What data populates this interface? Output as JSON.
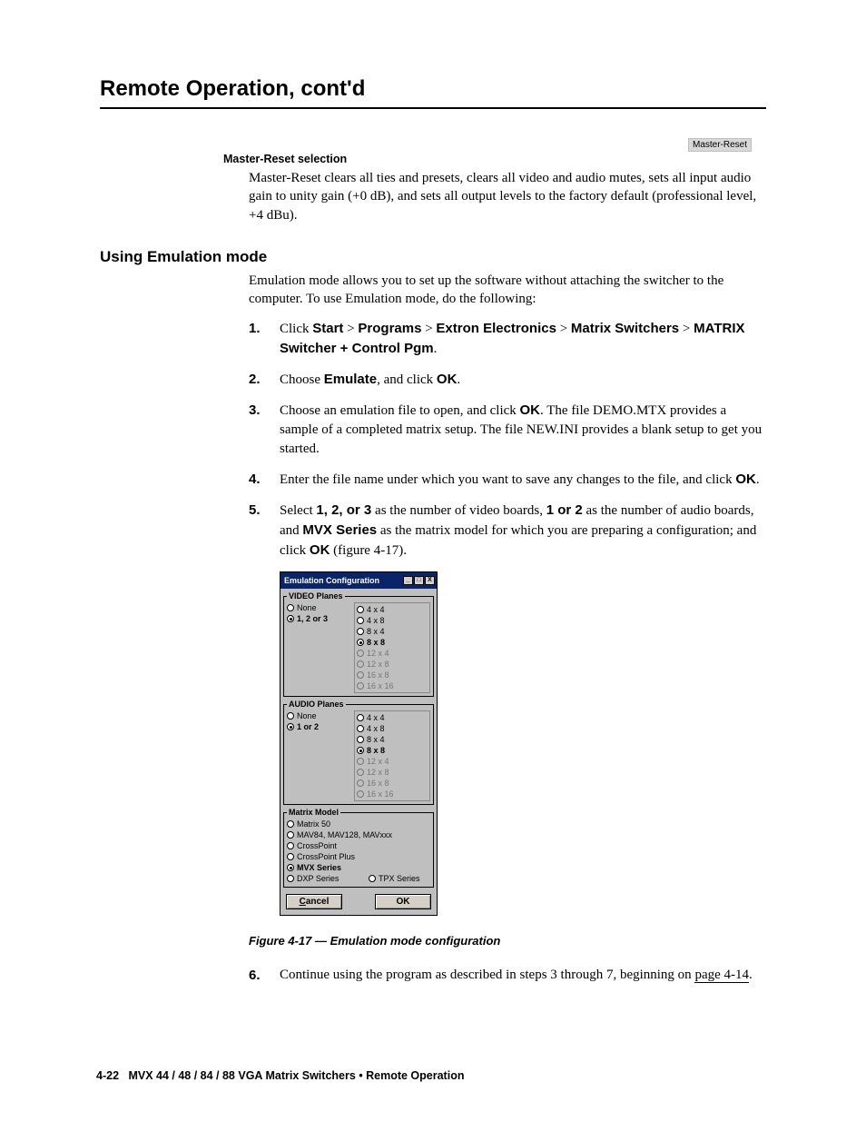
{
  "chapter_title": "Remote Operation, cont'd",
  "master_reset": {
    "heading": "Master-Reset selection",
    "body": "Master-Reset clears all ties and presets, clears all video and audio mutes, sets all input audio gain to unity gain (+0 dB), and sets all output levels to the factory default (professional level, +4 dBu).",
    "badge": "Master-Reset"
  },
  "emu": {
    "heading": "Using Emulation mode",
    "intro": "Emulation mode allows you to set up the software without attaching the switcher to the computer.  To use Emulation mode, do the following:",
    "steps": {
      "s1": {
        "num": "1.",
        "pre": "Click ",
        "b1": "Start",
        "g1": " > ",
        "b2": "Programs",
        "g2": " > ",
        "b3": "Extron Electronics",
        "g3": " > ",
        "b4": "Matrix Switchers",
        "g4": " > ",
        "b5": "MATRIX Switcher + Control Pgm",
        "post": "."
      },
      "s2": {
        "num": "2.",
        "pre": "Choose ",
        "b1": "Emulate",
        "mid": ", and click ",
        "b2": "OK",
        "post": "."
      },
      "s3": {
        "num": "3.",
        "pre": "Choose an emulation file to open, and click ",
        "b1": "OK",
        "post": ".  The file DEMO.MTX provides a sample of a completed matrix setup.  The file NEW.INI provides a blank setup to get you started."
      },
      "s4": {
        "num": "4.",
        "pre": "Enter the file name under which you want to save any changes to the file, and click ",
        "b1": "OK",
        "post": "."
      },
      "s5": {
        "num": "5.",
        "pre": "Select ",
        "b1": "1, 2, or 3",
        "mid1": " as the number of video boards, ",
        "b2": "1 or 2",
        "mid2": " as the number of audio boards, and ",
        "b3": "MVX Series",
        "mid3": " as the matrix model for which you are preparing a configuration; and click ",
        "b4": "OK",
        "post": " (figure 4-17)."
      },
      "s6": {
        "num": "6.",
        "pre": "Continue using the program as described in steps 3 through 7, beginning on ",
        "link": "page 4-14",
        "post": "."
      }
    }
  },
  "dialog": {
    "title": "Emulation Configuration",
    "video_legend": "VIDEO Planes",
    "audio_legend": "AUDIO Planes",
    "model_legend": "Matrix Model",
    "video_left": {
      "none": "None",
      "sel": "1, 2 or 3"
    },
    "audio_left": {
      "none": "None",
      "sel": "1 or 2"
    },
    "sizes": {
      "s4x4": "4 x 4",
      "s4x8": "4 x 8",
      "s8x4": "8 x 4",
      "s8x8": "8 x 8",
      "s12x4": "12 x 4",
      "s12x8": "12 x 8",
      "s16x8": "16 x 8",
      "s16x16": "16 x 16"
    },
    "models": {
      "m50": "Matrix 50",
      "mav": "MAV84,  MAV128,  MAVxxx",
      "cp": "CrossPoint",
      "cpp": "CrossPoint Plus",
      "mvx": "MVX Series",
      "dxp": "DXP Series",
      "tpx": "TPX Series"
    },
    "btn_cancel_u": "C",
    "btn_cancel_rest": "ancel",
    "btn_ok": "OK"
  },
  "fig_caption": "Figure 4-17 — Emulation mode configuration",
  "footer": {
    "page": "4-22",
    "title": "MVX 44 / 48 / 84 / 88 VGA Matrix Switchers • Remote Operation"
  }
}
